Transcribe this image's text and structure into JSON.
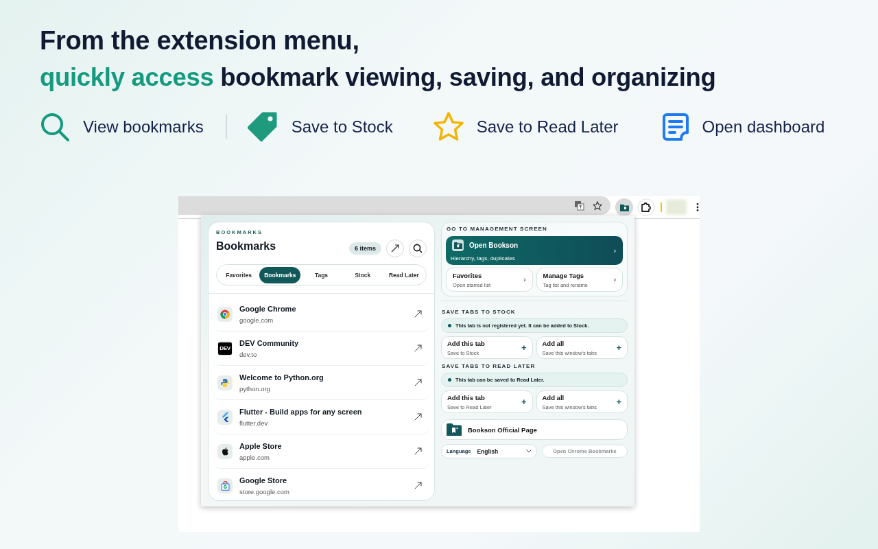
{
  "headline": {
    "line_1": "From the extension menu,",
    "line_2": [
      {
        "text": "quickly access",
        "accent": true
      },
      {
        "text": " bookmark viewing, saving, and organizing",
        "accent": false
      }
    ]
  },
  "features": [
    {
      "kind": "search",
      "label": "View bookmarks"
    },
    {
      "kind": "tag",
      "label": "Save to Stock"
    },
    {
      "kind": "star",
      "label": "Save to Read Later"
    },
    {
      "kind": "dashboard",
      "label": "Open dashboard"
    }
  ],
  "bookmarks_panel": {
    "eyebrow": "BOOKMARKS",
    "title": "Bookmarks",
    "count": "6 items",
    "tabs": [
      {
        "label": "Favorites",
        "selected": false
      },
      {
        "label": "Bookmarks",
        "selected": true
      },
      {
        "label": "Tags",
        "selected": false
      },
      {
        "label": "Stock",
        "selected": false
      },
      {
        "label": "Read Later",
        "selected": false
      }
    ],
    "items": [
      {
        "kind": "chrome",
        "title": "Google Chrome",
        "url": "google.com"
      },
      {
        "kind": "dev",
        "favicon_text": "DEV",
        "title": "DEV Community",
        "url": "dev.to"
      },
      {
        "kind": "python",
        "title": "Welcome to Python.org",
        "url": "python.org"
      },
      {
        "kind": "flutter",
        "title": "Flutter - Build apps for any screen",
        "url": "flutter.dev"
      },
      {
        "kind": "apple",
        "title": "Apple Store",
        "url": "apple.com"
      },
      {
        "kind": "gstore",
        "title": "Google Store",
        "url": "store.google.com"
      }
    ]
  },
  "management_panel": {
    "heading": "GO TO MANAGEMENT SCREEN",
    "primary": {
      "title": "Open Bookson",
      "subtitle": "Hierarchy, tags, duplicates",
      "chevron": "›"
    },
    "links": [
      {
        "title": "Favorites",
        "subtitle": "Open starred list",
        "chevron": "›"
      },
      {
        "title": "Manage Tags",
        "subtitle": "Tag list and rename",
        "chevron": "›"
      }
    ],
    "sections": [
      {
        "heading": "SAVE TABS TO STOCK",
        "notice": "This tab is not registered yet. It can be added to Stock.",
        "actions": [
          {
            "title": "Add this tab",
            "subtitle": "Save to Stock",
            "icon": "+"
          },
          {
            "title": "Add all",
            "subtitle": "Save this window's tabs",
            "icon": "+"
          }
        ]
      },
      {
        "heading": "SAVE TABS TO READ LATER",
        "notice": "This tab can be saved to Read Later.",
        "actions": [
          {
            "title": "Add this tab",
            "subtitle": "Save to Read Later",
            "icon": "+"
          },
          {
            "title": "Add all",
            "subtitle": "Save this window's tabs",
            "icon": "+"
          }
        ]
      }
    ],
    "official_page": "Bookson Official Page",
    "language": {
      "label": "Language",
      "value": "English"
    },
    "chrome_bookmarks": "Open Chrome Bookmarks"
  }
}
